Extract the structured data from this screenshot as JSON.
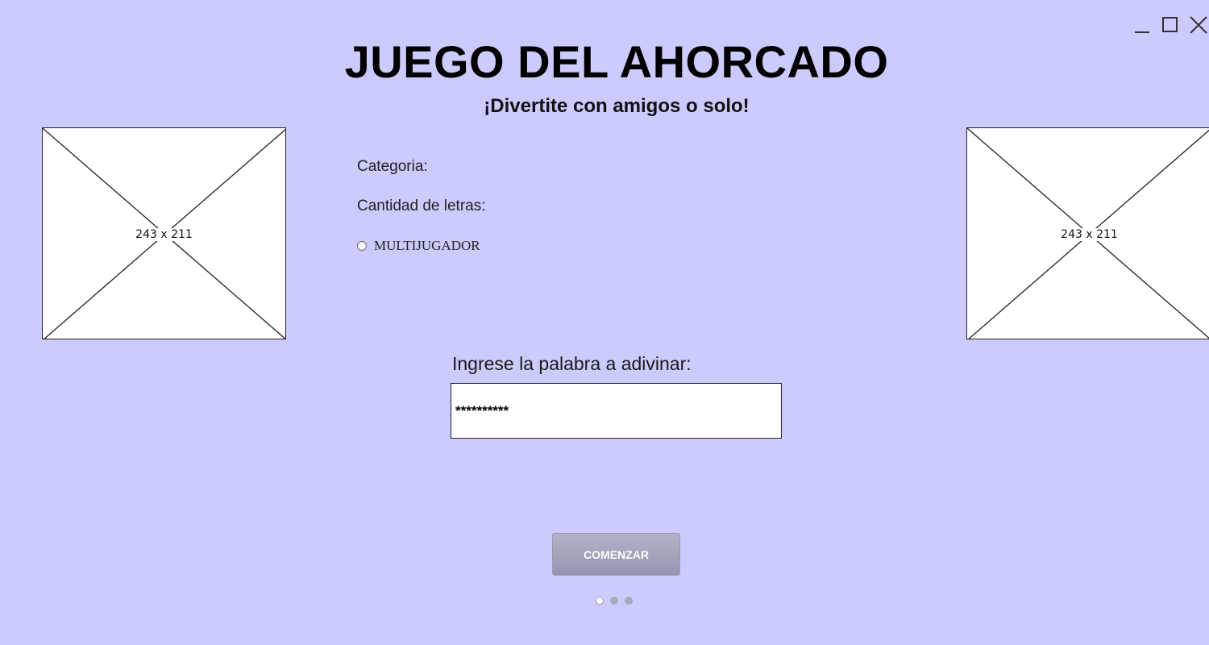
{
  "window": {
    "controls": [
      "minimize-icon",
      "maximize-icon",
      "close-icon"
    ]
  },
  "header": {
    "title": "JUEGO DEL AHORCADO",
    "subtitle": "¡Divertite con amigos o solo!"
  },
  "images": {
    "left_label": "243 x 211",
    "right_label": "243 x 211"
  },
  "form": {
    "category_label": "Categoria:",
    "letters_label": "Cantidad de letras:",
    "multiplayer_label": "MULTIJUGADOR",
    "multiplayer_checked": false,
    "word_label": "Ingrese la palabra a adivinar:",
    "word_value": "**********",
    "start_button": "COMENZAR"
  },
  "pager": {
    "pages": 3,
    "active": 1
  },
  "colors": {
    "background": "#cbcbfd",
    "button_gradient_top": "#b3b3c7",
    "button_gradient_bottom": "#9494b1"
  }
}
